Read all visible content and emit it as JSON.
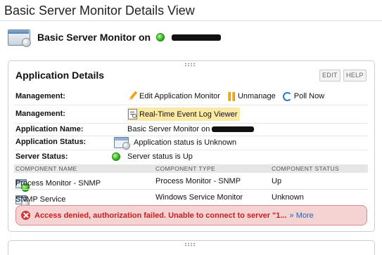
{
  "page": {
    "title": "Basic Server Monitor Details View"
  },
  "app_header": {
    "label": "Basic Server Monitor on"
  },
  "panel": {
    "title": "Application Details",
    "edit_label": "EDIT",
    "help_label": "HELP",
    "management_label": "Management:",
    "management_label_2": "Management:",
    "edit_app_monitor": "Edit Application Monitor",
    "unmanage": "Unmanage",
    "poll_now": "Poll Now",
    "event_log_viewer": "Real-Time Event Log Viewer",
    "app_name_label": "Application Name:",
    "app_name_value": "Basic Server Monitor on",
    "app_status_label": "Application Status:",
    "app_status_value": "Application status is Unknown",
    "server_status_label": "Server Status:",
    "server_status_value": "Server status is Up"
  },
  "components": {
    "headers": [
      "COMPONENT NAME",
      "COMPONENT TYPE",
      "COMPONENT STATUS"
    ],
    "rows": [
      {
        "name": "Process Monitor - SNMP",
        "type": "Process Monitor - SNMP",
        "status": "Up"
      },
      {
        "name": "SNMP Service",
        "type": "Windows Service Monitor",
        "status": "Unknown"
      }
    ]
  },
  "error": {
    "message": "Access denied, authorization failed. Unable to connect to server \"1...",
    "more": "» More"
  },
  "colors": {
    "status_up": "#21a90d",
    "error_text": "#c81e1e",
    "link_blue": "#2e62a8"
  }
}
